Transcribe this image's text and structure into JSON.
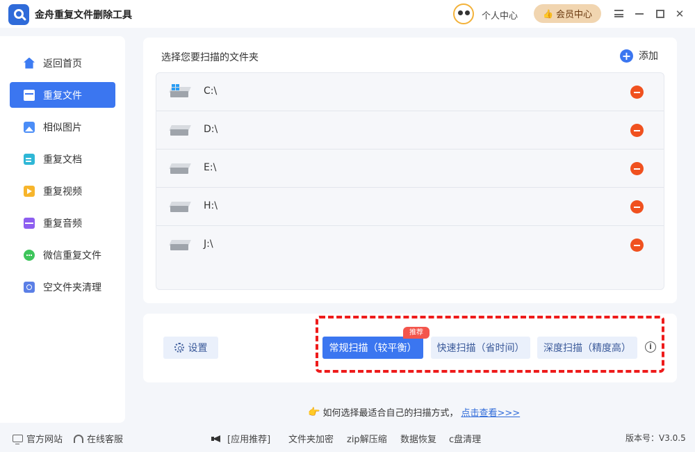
{
  "app": {
    "title": "金舟重复文件删除工具",
    "personal_center": "个人中心",
    "vip_center": "会员中心"
  },
  "sidebar": {
    "items": [
      {
        "label": "返回首页",
        "icon": "home-icon"
      },
      {
        "label": "重复文件",
        "icon": "folder-icon",
        "active": true
      },
      {
        "label": "相似图片",
        "icon": "image-icon"
      },
      {
        "label": "重复文档",
        "icon": "doc-icon"
      },
      {
        "label": "重复视频",
        "icon": "video-icon"
      },
      {
        "label": "重复音频",
        "icon": "audio-icon"
      },
      {
        "label": "微信重复文件",
        "icon": "wechat-icon"
      },
      {
        "label": "空文件夹清理",
        "icon": "empty-folder-icon"
      }
    ]
  },
  "folders": {
    "title": "选择您要扫描的文件夹",
    "add_label": "添加",
    "items": [
      {
        "label": "C:\\",
        "icon": "windows-drive-icon"
      },
      {
        "label": "D:\\",
        "icon": "drive-icon"
      },
      {
        "label": "E:\\",
        "icon": "drive-icon"
      },
      {
        "label": "H:\\",
        "icon": "drive-icon"
      },
      {
        "label": "J:\\",
        "icon": "drive-icon"
      }
    ]
  },
  "scan": {
    "settings_label": "设置",
    "normal_label": "常规扫描（较平衡）",
    "fast_label": "快速扫描（省时间）",
    "deep_label": "深度扫描（精度高）",
    "badge": "推荐",
    "info": "i"
  },
  "tip": {
    "text": "如何选择最适合自己的扫描方式，",
    "link": "点击查看>>>"
  },
  "footer": {
    "website": "官方网站",
    "support": "在线客服",
    "recommend": "[应用推荐]",
    "links": [
      "文件夹加密",
      "zip解压缩",
      "数据恢复",
      "c盘清理"
    ],
    "version": "版本号：V3.0.5"
  },
  "colors": {
    "accent": "#3b76f0",
    "remove": "#f0511f",
    "highlight_frame": "#ee1b1b",
    "vip": "#f1d5b0"
  }
}
